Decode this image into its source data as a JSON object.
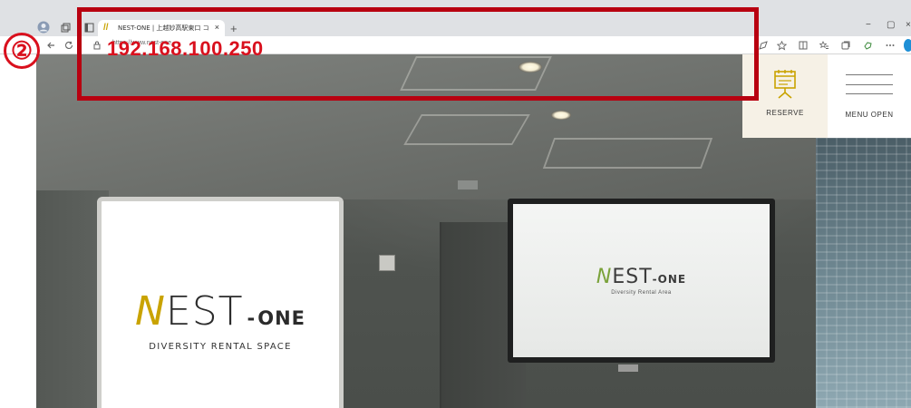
{
  "browser": {
    "tab_title": "NEST-ONE | 上越妙高駅東口 コワ",
    "tab_close": "×",
    "new_tab": "+",
    "url": "https://www.nest-one",
    "ip_overlay": "192.168.100.250",
    "window_minimize": "−",
    "window_restore": "▢",
    "window_close": "×"
  },
  "annotation": {
    "step": "②",
    "accent_color": "#b80010"
  },
  "nav": {
    "reserve_label": "RESERVE",
    "menu_label": "MENU OPEN"
  },
  "hero_card": {
    "logo_n": "N",
    "logo_est": "EST",
    "logo_dash": "-",
    "logo_one": "ONE",
    "tagline": "DIVERSITY RENTAL SPACE"
  },
  "tv": {
    "logo_n": "N",
    "logo_est": "EST",
    "logo_one": "-ONE",
    "tagline": "Diversity Rental Area"
  },
  "colors": {
    "brand_gold": "#c9a300",
    "brand_green": "#7aa23a",
    "reserve_bg": "#f6f1e6"
  }
}
